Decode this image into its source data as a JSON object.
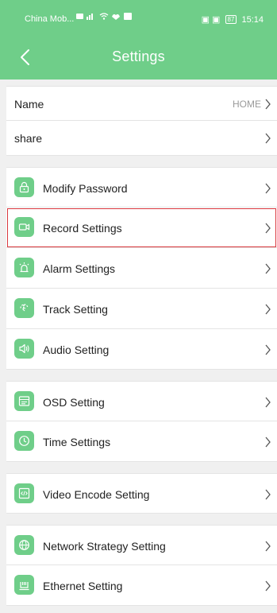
{
  "status_bar": {
    "carrier": "China Mob...",
    "battery": "87",
    "time": "15:14"
  },
  "header": {
    "title": "Settings",
    "back_icon": "chevron-left-icon"
  },
  "accent_color": "#6fce89",
  "highlight_color": "#d9373d",
  "name_row": {
    "label": "Name",
    "value": "HOME"
  },
  "share_row": {
    "label": "share"
  },
  "items": [
    {
      "label": "Modify Password",
      "icon": "lock-icon"
    },
    {
      "label": "Record Settings",
      "icon": "video-camera-icon",
      "highlighted": true
    },
    {
      "label": "Alarm Settings",
      "icon": "alarm-icon"
    },
    {
      "label": "Track Setting",
      "icon": "track-icon"
    },
    {
      "label": "Audio Setting",
      "icon": "speaker-icon"
    },
    {
      "label": "OSD Setting",
      "icon": "osd-icon"
    },
    {
      "label": "Time Settings",
      "icon": "clock-icon"
    },
    {
      "label": "Video Encode Setting",
      "icon": "code-icon"
    },
    {
      "label": "Network Strategy Setting",
      "icon": "globe-icon"
    },
    {
      "label": "Ethernet Setting",
      "icon": "ethernet-icon"
    }
  ]
}
